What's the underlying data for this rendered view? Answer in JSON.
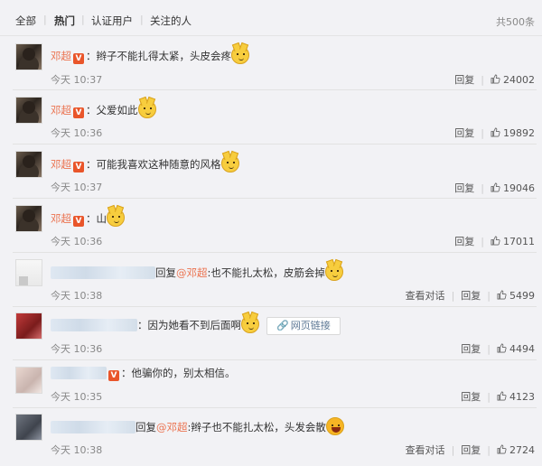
{
  "tabs": [
    {
      "label": "全部",
      "active": false
    },
    {
      "label": "热门",
      "active": true
    },
    {
      "label": "认证用户",
      "active": false
    },
    {
      "label": "关注的人",
      "active": false
    }
  ],
  "total_label": "共500条",
  "actions": {
    "reply": "回复",
    "view_conversation": "查看对话"
  },
  "comments": [
    {
      "user": "邓超",
      "text": "：辫子不能扎得太紧，头皮会疼",
      "time": "今天 10:37",
      "likes": "24002",
      "emoji": "cat-emoji-icon"
    },
    {
      "user": "邓超",
      "text": "：父爱如此",
      "time": "今天 10:36",
      "likes": "19892",
      "emoji": "cat-emoji-icon"
    },
    {
      "user": "邓超",
      "text": "：可能我喜欢这种随意的风格",
      "time": "今天 10:37",
      "likes": "19046",
      "emoji": "cat-emoji-icon"
    },
    {
      "user": "邓超",
      "text": "：山",
      "time": "今天 10:36",
      "likes": "17011",
      "emoji": "cat-emoji-icon"
    },
    {
      "prefix": "回复",
      "mention": "@邓超",
      "text": ":也不能扎太松，皮筋会掉",
      "time": "今天 10:38",
      "likes": "5499",
      "emoji": "cat-emoji-icon"
    },
    {
      "text": "：因为她看不到后面啊",
      "link_label": "网页链接",
      "time": "今天 10:36",
      "likes": "4494",
      "emoji": "cat-emoji-icon"
    },
    {
      "text": "：他骗你的，别太相信。",
      "time": "今天 10:35",
      "likes": "4123"
    },
    {
      "prefix": "回复",
      "mention": "@邓超",
      "text": ":辫子也不能扎太松，头发会散",
      "time": "今天 10:38",
      "likes": "2724",
      "emoji": "laughing-emoji-icon"
    }
  ],
  "colors": {
    "username": "#eb7350",
    "background": "#f2f2f5",
    "verified_badge": "#e9552a"
  }
}
